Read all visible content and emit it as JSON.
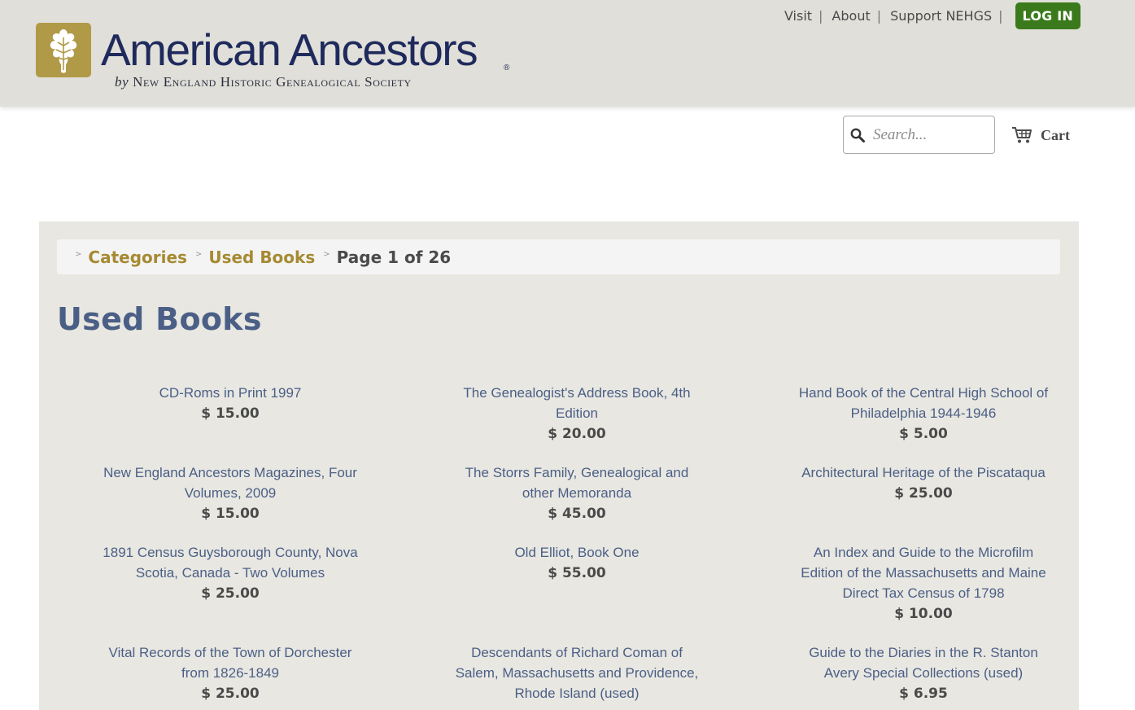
{
  "header": {
    "logo": {
      "title": "American Ancestors",
      "registered": "®",
      "subtitle_by": "by",
      "subtitle": "New England Historic Genealogical Society"
    },
    "nav": [
      {
        "label": "Visit",
        "sep": "|"
      },
      {
        "label": "About",
        "sep": "|"
      },
      {
        "label": "Support NEHGS",
        "sep": "|"
      }
    ],
    "login_label": "LOG IN",
    "login_color": "#3b7a1c",
    "background_color": "#e0dfd9"
  },
  "search": {
    "placeholder": "Search...",
    "value": "",
    "icon": "search-icon"
  },
  "cart": {
    "label": "Cart",
    "icon": "cart-icon"
  },
  "breadcrumb": {
    "items": [
      {
        "label": "Categories"
      },
      {
        "label": "Used Books"
      }
    ],
    "current": "Page 1 of 26",
    "separator": ">"
  },
  "page": {
    "title": "Used Books",
    "title_color": "#4b5f86",
    "link_color": "#a68a32"
  },
  "products": [
    {
      "title": "CD-Roms in Print 1997",
      "price": "$ 15.00"
    },
    {
      "title": "The Genealogist's Address Book, 4th Edition",
      "price": "$ 20.00"
    },
    {
      "title": "Hand Book of the Central High School of Philadelphia 1944-1946",
      "price": "$ 5.00"
    },
    {
      "title": "New England Ancestors Magazines, Four Volumes, 2009",
      "price": "$ 15.00"
    },
    {
      "title": "The Storrs Family, Genealogical and other Memoranda",
      "price": "$ 45.00"
    },
    {
      "title": "Architectural Heritage of the Piscataqua",
      "price": "$ 25.00"
    },
    {
      "title": "1891 Census Guysborough County, Nova Scotia, Canada - Two Volumes",
      "price": "$ 25.00"
    },
    {
      "title": "Old Elliot, Book One",
      "price": "$ 55.00"
    },
    {
      "title": "An Index and Guide to the Microfilm Edition of the Massachusetts and Maine Direct Tax Census of 1798",
      "price": "$ 10.00"
    },
    {
      "title": "Vital Records of the Town of Dorchester from 1826-1849",
      "price": "$ 25.00"
    },
    {
      "title": "Descendants of Richard Coman of Salem, Massachusetts and Providence, Rhode Island (used)",
      "price": ""
    },
    {
      "title": "Guide to the Diaries in the R. Stanton Avery Special Collections (used)",
      "price": "$ 6.95"
    }
  ]
}
